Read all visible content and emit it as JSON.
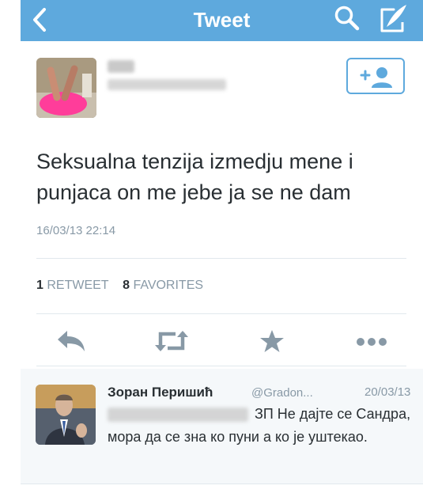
{
  "nav": {
    "title": "Tweet",
    "background_color": "#5ea9dd",
    "back_icon": "chevron-left",
    "search_icon": "magnifier",
    "compose_icon": "quill"
  },
  "tweet": {
    "text": "Seksualna tenzija izmedju mene i punjaca on me jebe ja se ne dam",
    "timestamp": "16/03/13 22:14",
    "follow_icon": "add-user"
  },
  "stats": {
    "retweets_count": "1",
    "retweets_label": "RETWEET",
    "favorites_count": "8",
    "favorites_label": "FAVORITES"
  },
  "actions": [
    {
      "name": "reply",
      "icon": "reply-arrow"
    },
    {
      "name": "retweet",
      "icon": "retweet-arrows"
    },
    {
      "name": "favorite",
      "icon": "star"
    },
    {
      "name": "more",
      "icon": "ellipsis"
    }
  ],
  "reply": {
    "author_name": "Зоран Перишић",
    "handle": "@Gradon...",
    "date": "20/03/13",
    "text": "ЗП Не дајте се Сандра, мора да се зна ко пуни а ко је уштекао."
  },
  "colors": {
    "accent": "#5ea9dd",
    "text": "#292f33",
    "muted": "#8899a6",
    "icon": "#8899a6"
  }
}
